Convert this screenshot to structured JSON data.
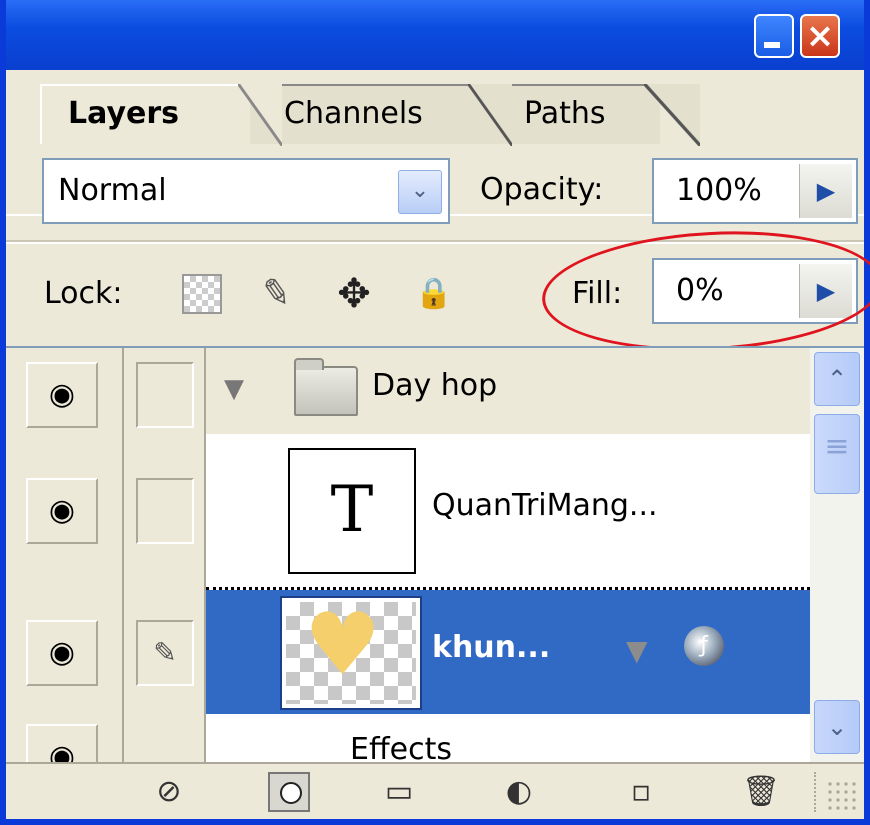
{
  "tabs": [
    "Layers",
    "Channels",
    "Paths"
  ],
  "blend_mode": "Normal",
  "opacity": {
    "label": "Opacity:",
    "value": "100%"
  },
  "lock": {
    "label": "Lock:"
  },
  "fill": {
    "label": "Fill:",
    "value": "0%"
  },
  "layers": {
    "group": {
      "name": "Day hop"
    },
    "text_layer": {
      "name": "QuanTriMang...",
      "thumb": "T"
    },
    "shape_layer": {
      "name": "khun..."
    },
    "effects_label": "Effects"
  },
  "icons": {
    "menu": "flyout-menu-icon",
    "eye": "eye-icon",
    "brush": "brush-icon",
    "move": "move-icon",
    "lock": "padlock-icon",
    "trash": "trash-icon"
  },
  "colors": {
    "selected_row": "#316ac5",
    "highlight_oval": "#e0141e",
    "heart": "#f4cf6b"
  }
}
